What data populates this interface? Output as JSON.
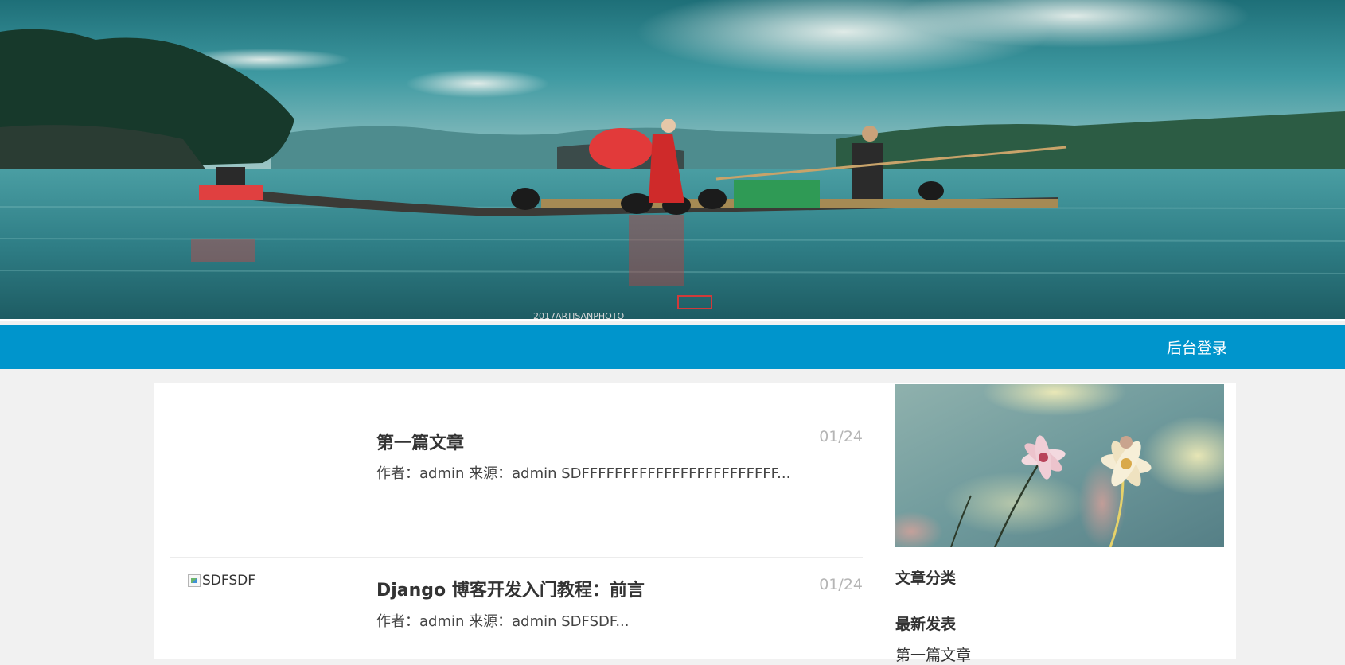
{
  "banner": {
    "watermark": "2017ARTISANPHOTO"
  },
  "nav": {
    "login_label": "后台登录"
  },
  "articles": [
    {
      "title": "第一篇文章",
      "date": "01/24",
      "meta": "作者：admin 来源：admin SDFFFFFFFFFFFFFFFFFFFFFFFF...",
      "thumb_alt": ""
    },
    {
      "title": "Django 博客开发入门教程：前言",
      "date": "01/24",
      "meta": "作者：admin 来源：admin SDFSDF...",
      "thumb_alt": "SDFSDF"
    }
  ],
  "sidebar": {
    "categories_heading": "文章分类",
    "latest_heading": "最新发表",
    "latest_items": [
      "第一篇文章"
    ]
  },
  "colors": {
    "nav": "#0095cc",
    "page_bg": "#f1f1f1",
    "card_bg": "#ffffff"
  }
}
